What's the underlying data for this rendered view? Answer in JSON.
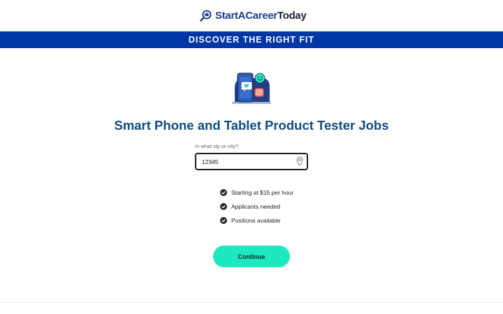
{
  "header": {
    "logo_part1": "StartACareer",
    "logo_part2": "Today"
  },
  "banner": {
    "text": "DISCOVER THE RIGHT FIT"
  },
  "main": {
    "title": "Smart Phone and Tablet Product Tester Jobs",
    "zip_label": "In what zip or city?",
    "zip_value": "12345",
    "benefits": [
      "Starting at $15 per hour",
      "Applicants needed",
      "Positions available"
    ],
    "continue_label": "Continue"
  },
  "colors": {
    "banner": "#0036a6",
    "title": "#0f4c81",
    "button": "#1ee8bd",
    "check": "#2b2b2b"
  },
  "icons": {
    "logo": "magnifier-briefcase-icon",
    "location": "map-pin-icon",
    "check": "check-circle-icon",
    "illustration": "phone-tablet-emoji-illustration"
  }
}
